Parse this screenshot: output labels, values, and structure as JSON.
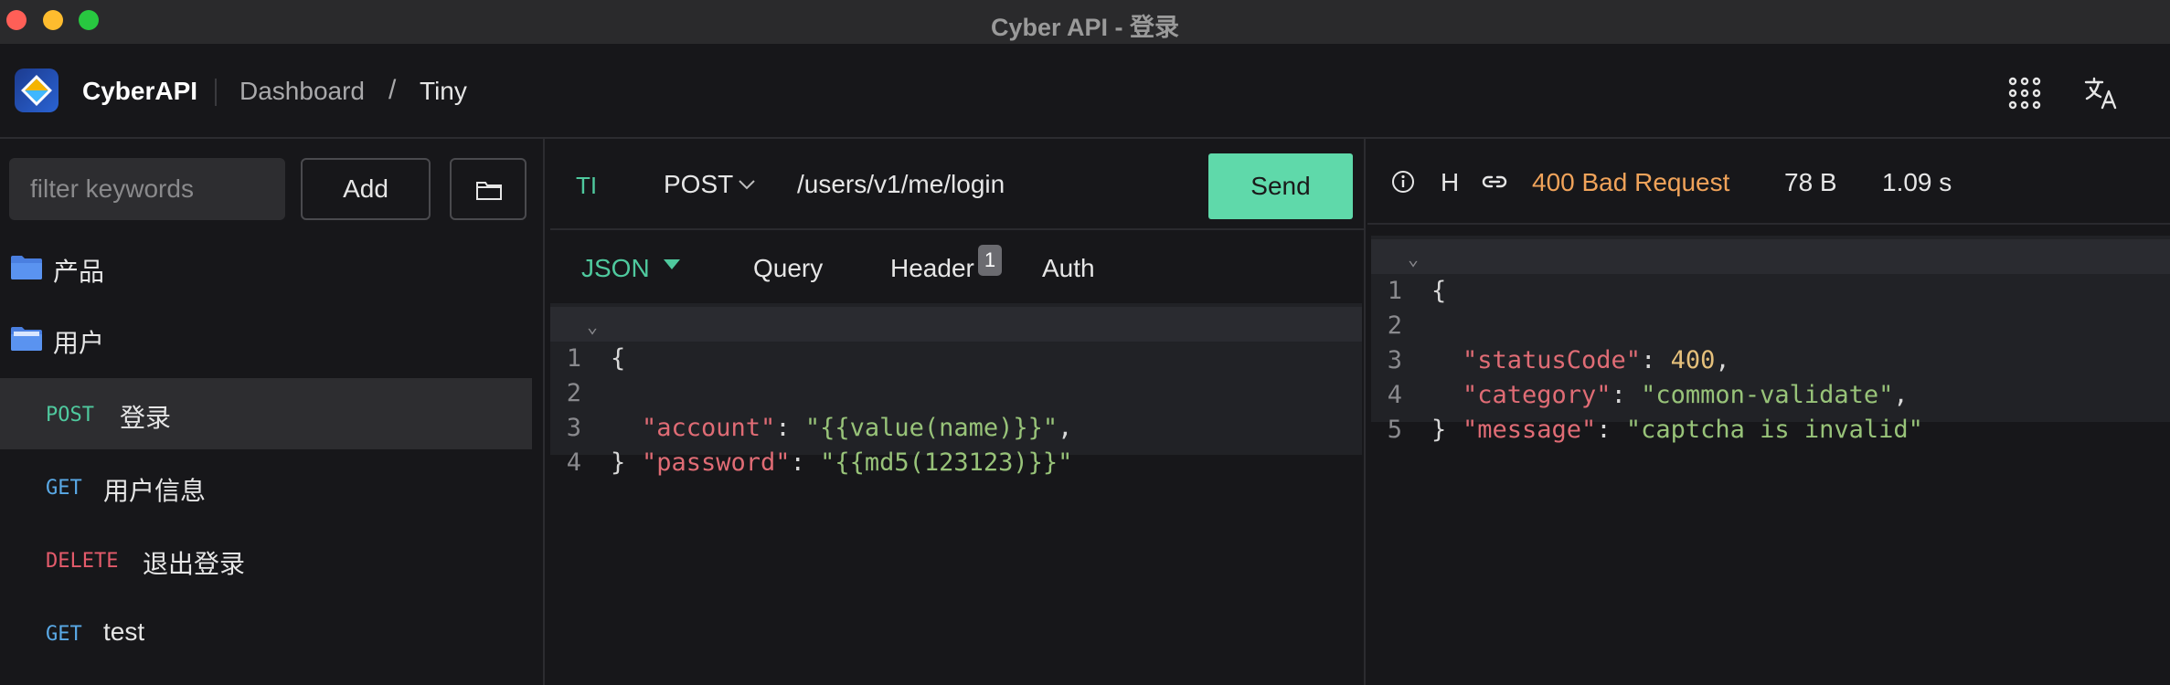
{
  "window": {
    "title": "Cyber API - 登录"
  },
  "header": {
    "brand": "CyberAPI",
    "breadcrumb": [
      "Dashboard",
      "/",
      "Tiny"
    ]
  },
  "sidebar": {
    "filter_placeholder": "filter keywords",
    "add_label": "Add",
    "folders": [
      {
        "label": "产品"
      },
      {
        "label": "用户"
      }
    ],
    "requests": [
      {
        "method": "POST",
        "label": "登录",
        "active": true
      },
      {
        "method": "GET",
        "label": "用户信息"
      },
      {
        "method": "DELETE",
        "label": "退出登录"
      },
      {
        "method": "GET",
        "label": "test"
      }
    ]
  },
  "request": {
    "type": "TI",
    "method": "POST",
    "url": "/users/v1/me/login",
    "send_label": "Send",
    "tabs": [
      {
        "label": "JSON",
        "active": true
      },
      {
        "label": "Query"
      },
      {
        "label": "Header",
        "badge": "1"
      },
      {
        "label": "Auth"
      }
    ],
    "line_numbers": [
      "1",
      "2",
      "3",
      "4"
    ],
    "body": {
      "open": "{",
      "account_key": "\"account\"",
      "account_value": "\"{{value(name)}}\"",
      "password_key": "\"password\"",
      "password_value": "\"{{md5(123123)}}\"",
      "close": "}"
    }
  },
  "response": {
    "h_label": "H",
    "status": "400 Bad Request",
    "size": "78 B",
    "time": "1.09 s",
    "line_numbers": [
      "1",
      "2",
      "3",
      "4",
      "5"
    ],
    "body": {
      "open": "{",
      "statusCode_key": "\"statusCode\"",
      "statusCode_value": "400",
      "category_key": "\"category\"",
      "category_value": "\"common-validate\"",
      "message_key": "\"message\"",
      "message_value": "\"captcha is invalid\"",
      "close": "}"
    }
  },
  "colors": {
    "accent_green": "#5fd9aa",
    "post": "#4fc99e",
    "get": "#5aa9e6",
    "delete": "#e45b6b",
    "status_warning": "#f0a35a"
  },
  "icons": [
    "apps-grid-icon",
    "translate-icon",
    "folder-icon",
    "info-icon",
    "link-icon",
    "chevron-down-icon"
  ]
}
